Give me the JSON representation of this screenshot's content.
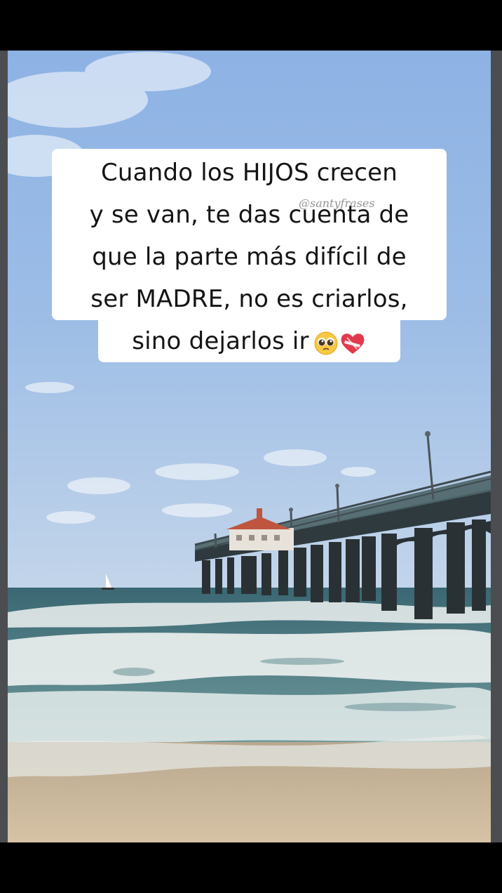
{
  "caption": {
    "lines": [
      "Cuando los HIJOS crecen",
      "y se van, te das cuenta de",
      "que la parte más difícil de",
      "ser MADRE, no es criarlos,",
      "sino dejarlos ir"
    ],
    "emojis": [
      "pleading-face-emoji",
      "mending-heart-emoji"
    ]
  },
  "watermark": "@santyfrases",
  "colors": {
    "sky_top": "#8fb3e3",
    "sky_bottom": "#b9cfe9",
    "sea": "#3f6f76",
    "foam": "#e9eeee",
    "sand": "#c9b69c",
    "pier": "#2b3236",
    "roof": "#c0553f"
  }
}
